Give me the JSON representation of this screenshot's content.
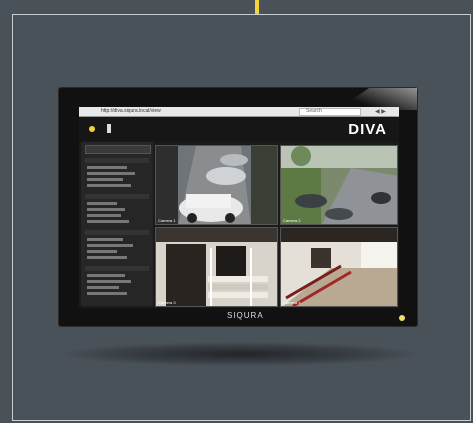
{
  "browser": {
    "url": "http://diva.siqura.local/view",
    "search_placeholder": "Search",
    "nav": "◀ ▶"
  },
  "app": {
    "brand": "DIVA",
    "footer_brand": "SIQURA"
  },
  "cameras": [
    {
      "label": "Camera 1"
    },
    {
      "label": "Camera 2"
    },
    {
      "label": "Camera 3"
    },
    {
      "label": "Camera 4"
    }
  ],
  "colors": {
    "background": "#4a5259",
    "accent": "#f2d43a"
  }
}
